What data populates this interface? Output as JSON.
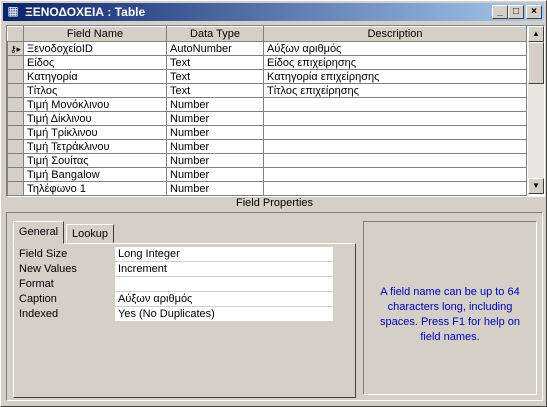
{
  "window": {
    "title": "ΞΕΝΟΔΟΧΕΙΑ : Table",
    "icon": "table-icon",
    "controls": [
      "minimize-icon",
      "maximize-icon",
      "close-icon"
    ]
  },
  "grid": {
    "columns": [
      "Field Name",
      "Data Type",
      "Description"
    ],
    "rows": [
      {
        "key": true,
        "name": "ΞενοδοχείοID",
        "type": "AutoNumber",
        "desc": "Αύξων αριθμός"
      },
      {
        "key": false,
        "name": "Είδος",
        "type": "Text",
        "desc": "Είδος επιχείρησης"
      },
      {
        "key": false,
        "name": "Κατηγορία",
        "type": "Text",
        "desc": "Κατηγορία επιχείρησης"
      },
      {
        "key": false,
        "name": "Τίτλος",
        "type": "Text",
        "desc": "Τίτλος επιχείρησης"
      },
      {
        "key": false,
        "name": "Τιμή Μονόκλινου",
        "type": "Number",
        "desc": ""
      },
      {
        "key": false,
        "name": "Τιμή Δίκλινου",
        "type": "Number",
        "desc": ""
      },
      {
        "key": false,
        "name": "Τιμή Τρίκλινου",
        "type": "Number",
        "desc": ""
      },
      {
        "key": false,
        "name": "Τιμή Τετράκλινου",
        "type": "Number",
        "desc": ""
      },
      {
        "key": false,
        "name": "Τιμή Σουίτας",
        "type": "Number",
        "desc": ""
      },
      {
        "key": false,
        "name": "Τιμή Bangalow",
        "type": "Number",
        "desc": ""
      },
      {
        "key": false,
        "name": "Τηλέφωνο 1",
        "type": "Number",
        "desc": ""
      }
    ]
  },
  "field_properties": {
    "label": "Field Properties",
    "tabs": [
      "General",
      "Lookup"
    ],
    "active_tab": "General",
    "properties": [
      {
        "label": "Field Size",
        "value": "Long Integer"
      },
      {
        "label": "New Values",
        "value": "Increment"
      },
      {
        "label": "Format",
        "value": ""
      },
      {
        "label": "Caption",
        "value": "Αύξων αριθμός"
      },
      {
        "label": "Indexed",
        "value": "Yes (No Duplicates)"
      }
    ],
    "help_text": "A field name can be up to 64 characters long, including spaces.  Press F1 for help on field names."
  }
}
